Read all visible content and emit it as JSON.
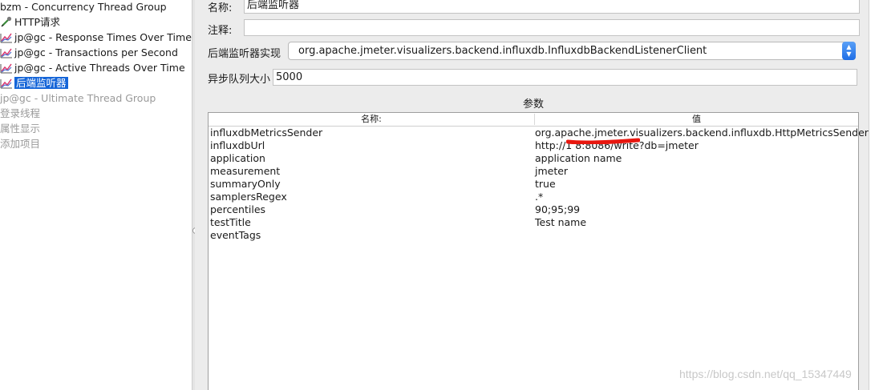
{
  "tree": {
    "items": [
      {
        "label": "bzm - Concurrency Thread Group",
        "state": "normal",
        "icon": "none"
      },
      {
        "label": "HTTP请求",
        "state": "normal",
        "icon": "pipette-icon"
      },
      {
        "label": "jp@gc - Response Times Over Time",
        "state": "normal",
        "icon": "graph-icon"
      },
      {
        "label": "jp@gc - Transactions per Second",
        "state": "normal",
        "icon": "graph-icon"
      },
      {
        "label": "jp@gc - Active Threads Over Time",
        "state": "normal",
        "icon": "graph-icon"
      },
      {
        "label": "后端监听器",
        "state": "selected",
        "icon": "graph-icon"
      },
      {
        "label": "jp@gc - Ultimate Thread Group",
        "state": "disabled",
        "icon": "none"
      },
      {
        "label": "登录线程",
        "state": "disabled",
        "icon": "none"
      },
      {
        "label": "属性显示",
        "state": "disabled",
        "icon": "none"
      },
      {
        "label": "添加项目",
        "state": "disabled",
        "icon": "none"
      }
    ]
  },
  "form": {
    "name_label": "名称:",
    "name_value": "后端监听器",
    "comment_label": "注释:",
    "comment_value": "",
    "impl_label": "后端监听器实现",
    "impl_value": "org.apache.jmeter.visualizers.backend.influxdb.InfluxdbBackendListenerClient",
    "queue_label": "异步队列大小",
    "queue_value": "5000"
  },
  "params": {
    "title": "参数",
    "col_name": "名称:",
    "col_value": "值",
    "rows": [
      {
        "name": "influxdbMetricsSender",
        "value": "org.apache.jmeter.visualizers.backend.influxdb.HttpMetricsSender"
      },
      {
        "name": "influxdbUrl",
        "value": "http://1 8:8086/write?db=jmeter"
      },
      {
        "name": "application",
        "value": "application name"
      },
      {
        "name": "measurement",
        "value": "jmeter"
      },
      {
        "name": "summaryOnly",
        "value": "true"
      },
      {
        "name": "samplersRegex",
        "value": ".*"
      },
      {
        "name": "percentiles",
        "value": "90;95;99"
      },
      {
        "name": "testTitle",
        "value": "Test name"
      },
      {
        "name": "eventTags",
        "value": ""
      }
    ]
  },
  "watermark": "https://blog.csdn.net/qq_15347449",
  "colors": {
    "selection": "#1565d8",
    "redaction": "#e8170f",
    "panel_bg": "#ececec",
    "select_arrow": "#1f6ee6"
  }
}
